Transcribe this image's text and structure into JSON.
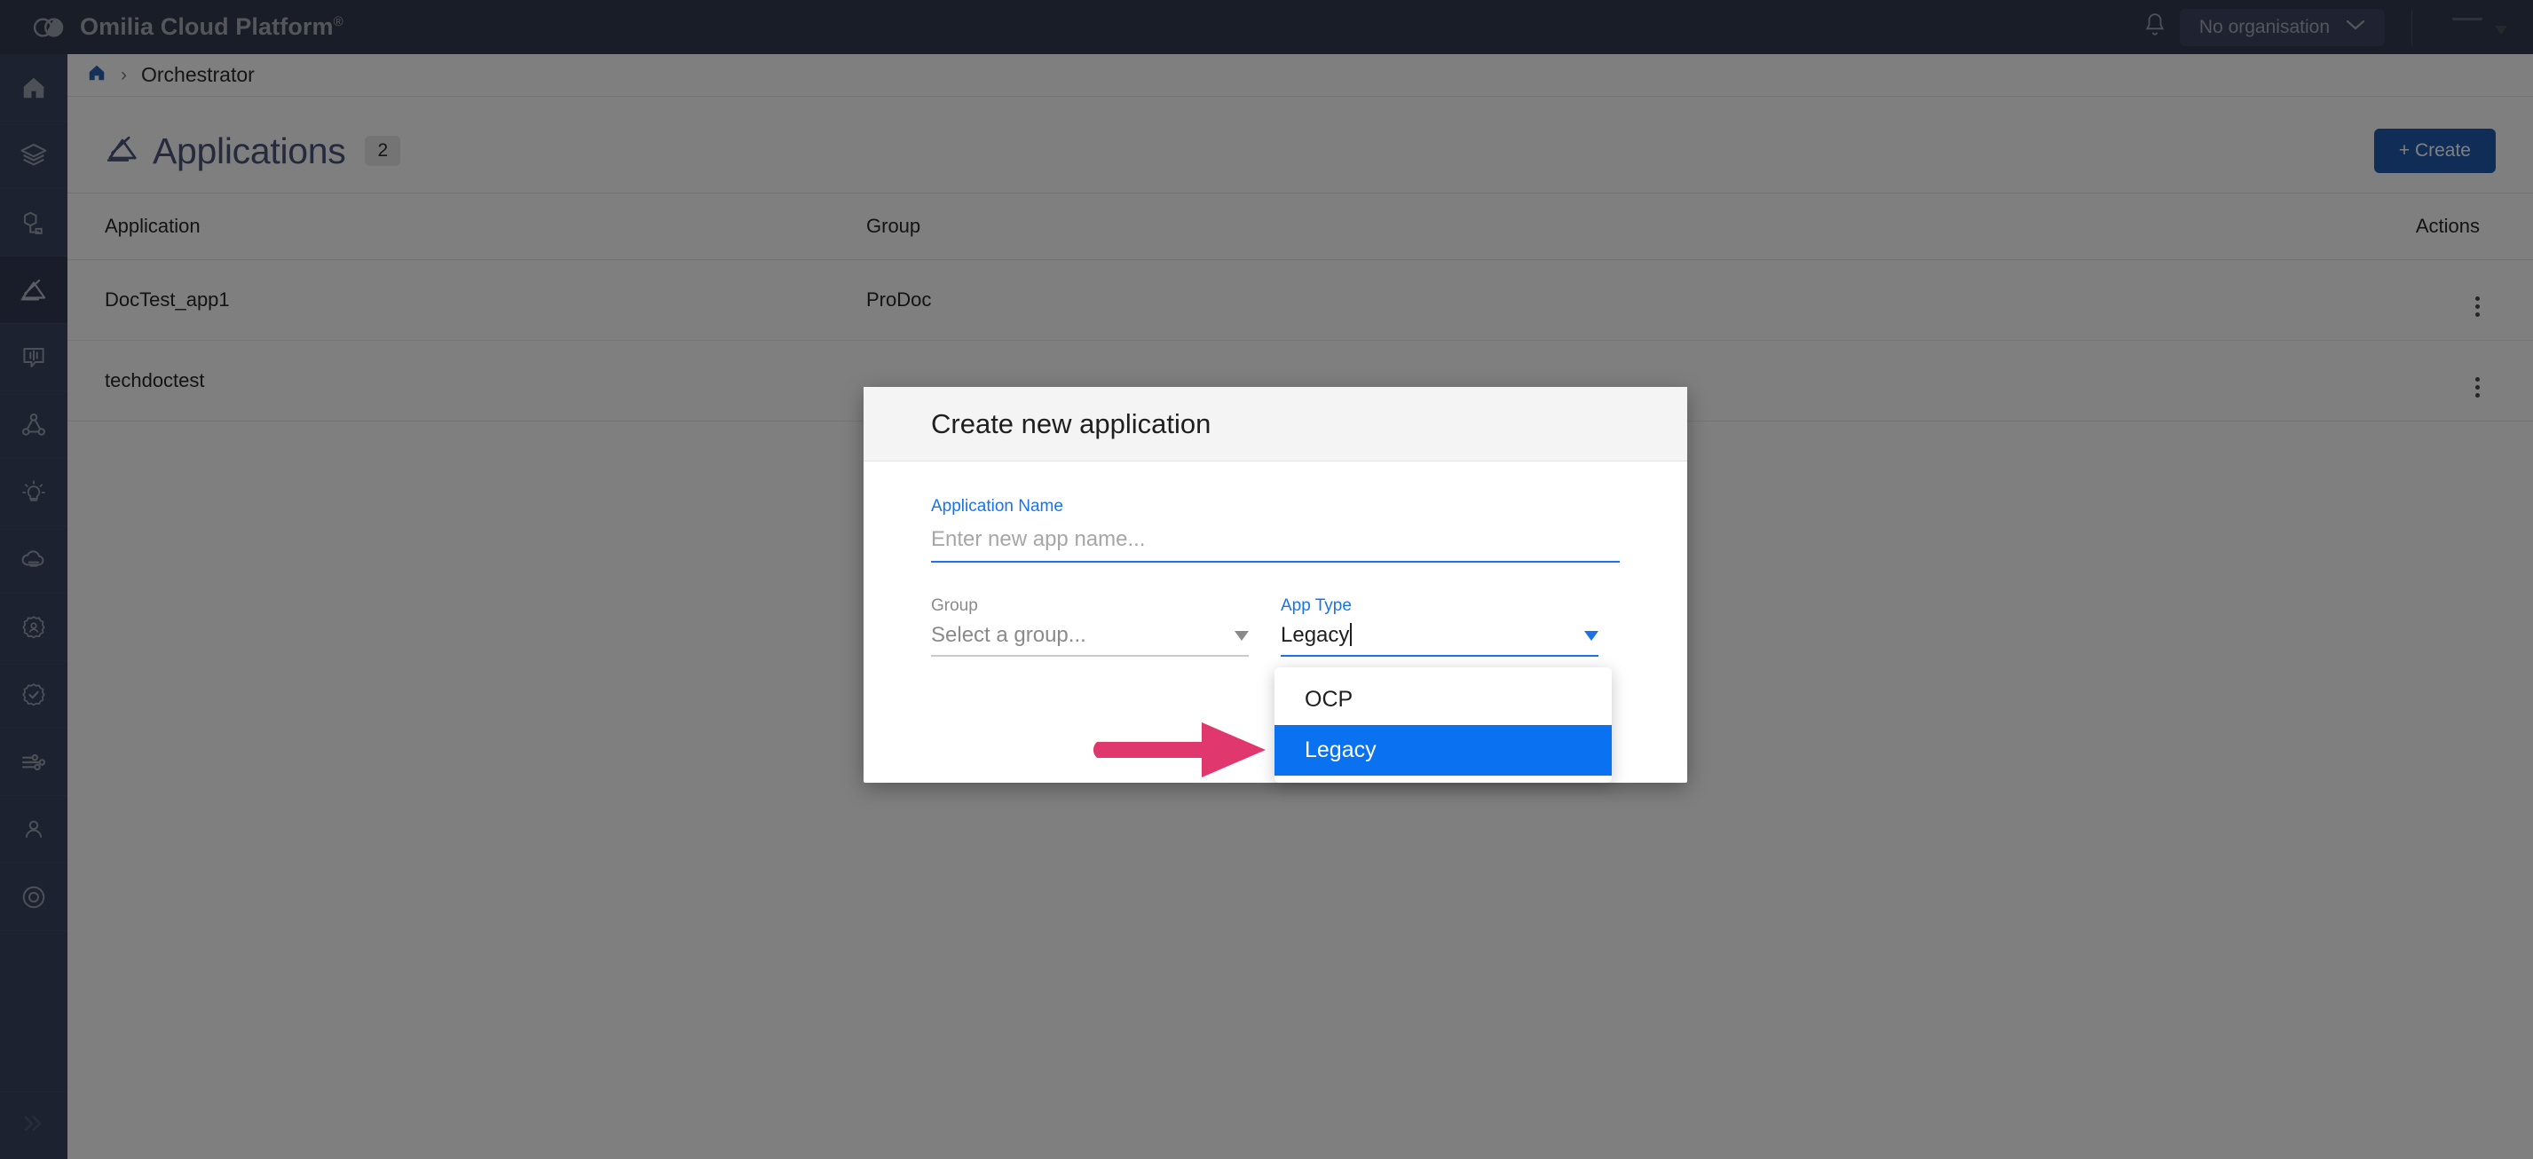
{
  "topbar": {
    "brand_name": "Omilia Cloud Platform",
    "brand_mark": "®",
    "logo_icon": "cloud-loop-logo",
    "notifications_icon": "bell-icon",
    "organisation_label": "No organisation",
    "organisation_caret_icon": "chevron-down-icon",
    "user_menu_icon": "user-avatar-icon"
  },
  "sidebar": {
    "items": [
      {
        "icon": "home-icon",
        "name": "home",
        "active": false
      },
      {
        "icon": "layers-icon",
        "name": "layers",
        "active": false
      },
      {
        "icon": "cube-tool-icon",
        "name": "toolbox",
        "active": false
      },
      {
        "icon": "orchestrator-icon",
        "name": "orchestrator",
        "active": true
      },
      {
        "icon": "speech-waveform-icon",
        "name": "speech",
        "active": false
      },
      {
        "icon": "graph-nodes-icon",
        "name": "graph",
        "active": false
      },
      {
        "icon": "lightbulb-icon",
        "name": "insights",
        "active": false
      },
      {
        "icon": "cloud-icon",
        "name": "cloud",
        "active": false
      },
      {
        "icon": "badge-user-icon",
        "name": "identity",
        "active": false
      },
      {
        "icon": "badge-check-icon",
        "name": "verification",
        "active": false
      },
      {
        "icon": "pipeline-icon",
        "name": "pipelines",
        "active": false
      },
      {
        "icon": "person-icon",
        "name": "profile",
        "active": false
      },
      {
        "icon": "lifebuoy-icon",
        "name": "support",
        "active": false
      }
    ],
    "collapse_icon": "double-chevron-right-icon"
  },
  "breadcrumb": {
    "home_icon": "home-icon",
    "separator": "›",
    "current": "Orchestrator"
  },
  "page": {
    "title_icon": "orchestrator-icon",
    "title": "Applications",
    "count": "2",
    "create_button": "+ Create"
  },
  "table": {
    "columns": [
      "Application",
      "Group",
      "Actions"
    ],
    "rows": [
      {
        "application": "DocTest_app1",
        "group": "ProDoc",
        "actions_icon": "kebab-menu-icon"
      },
      {
        "application": "techdoctest",
        "group": "",
        "actions_icon": "kebab-menu-icon"
      }
    ]
  },
  "modal": {
    "title": "Create new application",
    "fields": {
      "app_name": {
        "label": "Application Name",
        "value": "",
        "placeholder": "Enter new app name..."
      },
      "group": {
        "label": "Group",
        "value": "Select a group...",
        "caret_icon": "caret-down-icon"
      },
      "app_type": {
        "label": "App Type",
        "value": "Legacy",
        "caret_icon": "caret-down-icon"
      }
    }
  },
  "dropdown": {
    "name": "app-type-options",
    "options": [
      {
        "label": "OCP",
        "selected": false
      },
      {
        "label": "Legacy",
        "selected": true
      }
    ]
  },
  "annotation": {
    "arrow_icon": "pink-right-arrow-annotation",
    "color": "#e0376f"
  },
  "colors": {
    "topbar_bg": "#323b4f",
    "sidebar_bg": "#3b4560",
    "sidebar_active_bg": "#323b54",
    "accent_blue": "#1a73e8",
    "dropdown_selected_blue": "#0a72f0",
    "create_button_blue": "#1f5bad",
    "page_title": "#4a5578",
    "annotation_pink": "#e0376f"
  }
}
